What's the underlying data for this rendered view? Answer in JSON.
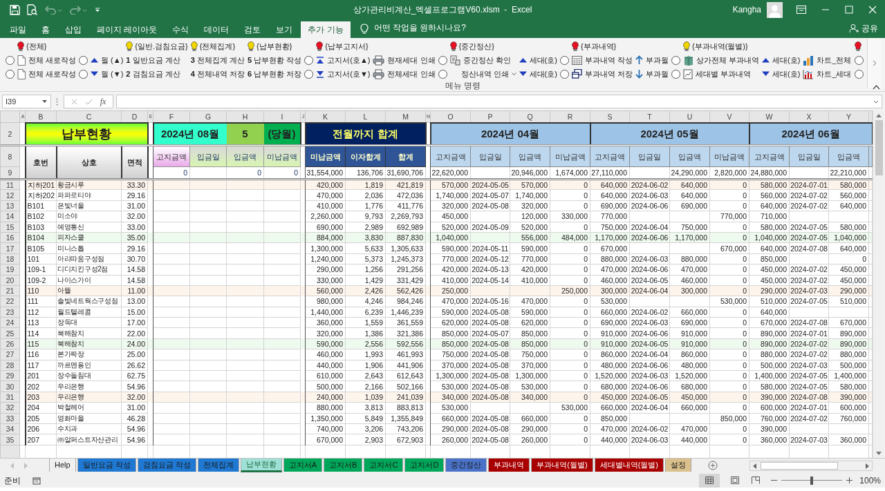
{
  "window": {
    "title": "상가관리비계산_엑셀프로그램V60.xlsm  -  Excel",
    "user": "Kangha"
  },
  "menu_tabs": [
    {
      "label": "파일",
      "selected": false
    },
    {
      "label": "홈",
      "selected": false
    },
    {
      "label": "삽입",
      "selected": false
    },
    {
      "label": "페이지 레이아웃",
      "selected": false
    },
    {
      "label": "수식",
      "selected": false
    },
    {
      "label": "데이터",
      "selected": false
    },
    {
      "label": "검토",
      "selected": false
    },
    {
      "label": "보기",
      "selected": false
    },
    {
      "label": "추가 기능",
      "selected": true
    }
  ],
  "tell_me": "어떤 작업을 원하시나요?",
  "share": "공유",
  "ribbon": {
    "group_label": "메뉴 명령",
    "columns": [
      {
        "items": [
          {
            "kind": "radio",
            "checked": false
          },
          {
            "kind": "radio",
            "checked": false
          }
        ]
      },
      {
        "header": {
          "text": "{전체}",
          "color": "#e81123"
        },
        "items": [
          {
            "kind": "command",
            "text": "전체 새로작성"
          },
          {
            "kind": "command",
            "text": "전체 새로작성"
          }
        ]
      },
      {
        "items": [
          {
            "kind": "radio",
            "checked": false
          },
          {
            "kind": "radio",
            "checked": false
          }
        ]
      },
      {
        "items": [
          {
            "kind": "command",
            "text": "월 (▲)"
          },
          {
            "kind": "command",
            "text": "월 (▼)"
          }
        ]
      },
      {
        "header": {
          "text": "{일반.검침요금}",
          "color": "#f2d600"
        },
        "items": [
          {
            "kind": "command",
            "text": "**1**  일반요금 계산"
          },
          {
            "kind": "command",
            "text": "**2**  검침요금 계산"
          }
        ]
      },
      {
        "header": {
          "text": "{전체집계}",
          "color": "#f2d600"
        },
        "items": [
          {
            "kind": "command",
            "text": "**3**  전체집계 계산"
          },
          {
            "kind": "command",
            "text": "**4**  전체내역 저장"
          }
        ]
      },
      {
        "header": {
          "text": "{납부현황}",
          "color": "#f2d600"
        },
        "items": [
          {
            "kind": "command",
            "text": "**5**  납부현황 작성"
          },
          {
            "kind": "command",
            "text": "**6**  납부현황 저장"
          }
        ]
      },
      {
        "items": [
          {
            "kind": "radio",
            "checked": false
          },
          {
            "kind": "radio",
            "checked": false
          }
        ]
      },
      {
        "header": {
          "text": "{납부고지서}",
          "color": "#e81123"
        },
        "items": [
          {
            "kind": "command",
            "text": "고지서(호▲)"
          },
          {
            "kind": "command",
            "text": "고지서(호▼)"
          }
        ]
      },
      {
        "items": [
          {
            "kind": "command",
            "text": "현재세대 인쇄"
          },
          {
            "kind": "command",
            "text": "전체세대 인쇄"
          }
        ]
      },
      {
        "items": [
          {
            "kind": "radio",
            "checked": false
          },
          {
            "kind": "radio",
            "checked": false
          }
        ]
      },
      {
        "header": {
          "text": "{중간정산}",
          "color": "#e81123"
        },
        "items": [
          {
            "kind": "command",
            "text": "중간정산 확인"
          },
          {
            "kind": "dropdown",
            "text": "정산내역 인쇄"
          }
        ]
      },
      {
        "items": [
          {
            "kind": "command",
            "text": "세대(호)"
          },
          {
            "kind": "command",
            "text": "세대(호)"
          }
        ]
      },
      {
        "items": [
          {
            "kind": "radio",
            "checked": false
          },
          {
            "kind": "radio",
            "checked": false
          }
        ]
      },
      {
        "header": {
          "text": "{부과내역}",
          "color": "#e81123"
        },
        "items": [
          {
            "kind": "command",
            "text": "부과내역 작성"
          },
          {
            "kind": "command",
            "text": "부과내역 저장"
          }
        ]
      },
      {
        "items": [
          {
            "kind": "command",
            "text": "부과월"
          },
          {
            "kind": "command",
            "text": "부과월"
          }
        ]
      },
      {
        "items": [
          {
            "kind": "radio",
            "checked": false
          },
          {
            "kind": "radio",
            "checked": false
          }
        ]
      },
      {
        "header": {
          "text": "{부과내역(월별)}",
          "color": "#f2d600"
        },
        "items": [
          {
            "kind": "command",
            "text": "상가전체 부과내역"
          },
          {
            "kind": "command",
            "text": "세대별 부과내역"
          }
        ]
      },
      {
        "items": [
          {
            "kind": "command",
            "text": "세대(호)"
          },
          {
            "kind": "command",
            "text": "세대(호)"
          }
        ]
      },
      {
        "items": [
          {
            "kind": "command",
            "text": "차트_전체"
          },
          {
            "kind": "command",
            "text": "차트_세대"
          }
        ]
      },
      {
        "header": {
          "color": "#e81123"
        },
        "items": [
          {
            "kind": "radio",
            "checked": false
          },
          {
            "kind": "radio",
            "checked": false
          }
        ]
      }
    ]
  },
  "formula_bar": {
    "name_box": "I39",
    "function_label": "fx"
  },
  "sheet": {
    "column_letters": [
      "A",
      "B",
      "C",
      "D",
      "E",
      "F",
      "G",
      "H",
      "I",
      "J",
      "K",
      "L",
      "M",
      "N",
      "O",
      "P",
      "Q",
      "R",
      "S",
      "T",
      "U",
      "V",
      "W",
      "X",
      "Y"
    ],
    "title": "납부현황",
    "period": {
      "month": "2024년 08월",
      "count": "5",
      "label": "(당월)"
    },
    "prior_title": "전월까지 합계",
    "month_titles": [
      "2024년 04월",
      "2024년 05월",
      "2024년 06월"
    ],
    "title_rows": [
      "2",
      "8",
      "9"
    ],
    "fixed_headers": [
      "호번",
      "상호",
      "면적"
    ],
    "current_headers": [
      "고지금액",
      "입금일",
      "입금액",
      "미납금액"
    ],
    "prior_headers": [
      "미납금액",
      "이자합계",
      "합계"
    ],
    "month_headers": [
      [
        "고지금액",
        "입금일",
        "입금액",
        "미납금액"
      ],
      [
        "고지금액",
        "입금일",
        "입금액",
        "미납금액"
      ],
      [
        "고지금액",
        "입금일",
        "입금액"
      ]
    ],
    "current_totals": {
      "billed": "0",
      "paid": "0",
      "unpaid": "0"
    },
    "prior_totals": [
      "31,554,000",
      "136,706",
      "31,690,706"
    ],
    "month_totals": [
      {
        "billed": "22,620,000",
        "paid": "20,946,000",
        "unpaid": "1,674,000"
      },
      {
        "billed": "27,110,000",
        "paid": "24,290,000",
        "unpaid": "2,820,000"
      },
      {
        "billed": "24,880,000",
        "paid": "22,210,000"
      }
    ],
    "rows": [
      {
        "num": "11",
        "color": "#fdf4ec",
        "unit": "지하201",
        "name": "황금시루",
        "area": "33.30",
        "prior": [
          "420,000",
          "1,819",
          "421,819"
        ],
        "months": [
          {
            "billed": "570,000",
            "date": "2024-05-05",
            "paid": "570,000",
            "unpaid": "0"
          },
          {
            "billed": "640,000",
            "date": "2024-06-02",
            "paid": "640,000",
            "unpaid": "0"
          },
          {
            "billed": "580,000",
            "date": "2024-07-01",
            "paid": "580,000"
          }
        ]
      },
      {
        "num": "12",
        "unit": "지하202",
        "name": "파파로티야",
        "area": "29.16",
        "prior": [
          "470,000",
          "2,036",
          "472,036"
        ],
        "months": [
          {
            "billed": "1,740,000",
            "date": "2024-05-07",
            "paid": "1,740,000",
            "unpaid": "0"
          },
          {
            "billed": "640,000",
            "date": "2024-06-03",
            "paid": "640,000",
            "unpaid": "0"
          },
          {
            "billed": "560,000",
            "date": "2024-07-02",
            "paid": "560,000"
          }
        ]
      },
      {
        "num": "13",
        "unit": "B101",
        "name": "은빛너울",
        "area": "31.00",
        "prior": [
          "410,000",
          "1,776",
          "411,776"
        ],
        "months": [
          {
            "billed": "320,000",
            "date": "2024-05-08",
            "paid": "320,000",
            "unpaid": "0"
          },
          {
            "billed": "690,000",
            "date": "2024-06-06",
            "paid": "690,000",
            "unpaid": "0"
          },
          {
            "billed": "640,000",
            "date": "2024-07-02",
            "paid": "640,000"
          }
        ]
      },
      {
        "num": "14",
        "unit": "B102",
        "name": "미소야",
        "area": "32.00",
        "prior": [
          "2,260,000",
          "9,793",
          "2,269,793"
        ],
        "months": [
          {
            "billed": "450,000",
            "paid": "120,000",
            "unpaid": "330,000"
          },
          {
            "billed": "770,000",
            "unpaid": "770,000"
          },
          {
            "billed": "710,000"
          }
        ]
      },
      {
        "num": "15",
        "unit": "B103",
        "name": "예영통신",
        "area": "33.00",
        "prior": [
          "690,000",
          "2,989",
          "692,989"
        ],
        "months": [
          {
            "billed": "520,000",
            "date": "2024-05-09",
            "paid": "520,000",
            "unpaid": "0"
          },
          {
            "billed": "750,000",
            "date": "2024-06-04",
            "paid": "750,000",
            "unpaid": "0"
          },
          {
            "billed": "580,000",
            "date": "2024-07-05",
            "paid": "580,000"
          }
        ]
      },
      {
        "num": "16",
        "color": "#effaef",
        "unit": "B104",
        "name": "피자스쿨",
        "area": "35.00",
        "prior": [
          "884,000",
          "3,830",
          "887,830"
        ],
        "months": [
          {
            "billed": "1,040,000",
            "paid": "556,000",
            "unpaid": "484,000"
          },
          {
            "billed": "1,170,000",
            "date": "2024-06-06",
            "paid": "1,170,000",
            "unpaid": "0"
          },
          {
            "billed": "1,040,000",
            "date": "2024-07-05",
            "paid": "1,040,000"
          }
        ]
      },
      {
        "num": "17",
        "unit": "B105",
        "name": "미니스톱",
        "area": "29.16",
        "prior": [
          "1,300,000",
          "5,633",
          "1,305,633"
        ],
        "months": [
          {
            "billed": "590,000",
            "date": "2024-05-11",
            "paid": "590,000",
            "unpaid": "0"
          },
          {
            "billed": "670,000",
            "unpaid": "670,000"
          },
          {
            "billed": "640,000",
            "date": "2024-07-08",
            "paid": "640,000"
          }
        ]
      },
      {
        "num": "18",
        "unit": "101",
        "name": "아리따움구성점",
        "area": "30.70",
        "prior": [
          "1,240,000",
          "5,373",
          "1,245,373"
        ],
        "months": [
          {
            "billed": "770,000",
            "date": "2024-05-12",
            "paid": "770,000",
            "unpaid": "0"
          },
          {
            "billed": "880,000",
            "date": "2024-06-03",
            "paid": "880,000",
            "unpaid": "0"
          },
          {
            "billed": "850,000",
            "paid": "0"
          }
        ]
      },
      {
        "num": "19",
        "unit": "109-1",
        "name": "디디치킨구성2점",
        "area": "14.58",
        "prior": [
          "290,000",
          "1,256",
          "291,256"
        ],
        "months": [
          {
            "billed": "420,000",
            "date": "2024-05-13",
            "paid": "420,000",
            "unpaid": "0"
          },
          {
            "billed": "470,000",
            "date": "2024-06-06",
            "paid": "470,000",
            "unpaid": "0"
          },
          {
            "billed": "450,000",
            "date": "2024-07-02",
            "paid": "450,000"
          }
        ]
      },
      {
        "num": "20",
        "unit": "109-2",
        "name": "나이스가이",
        "area": "14.58",
        "prior": [
          "330,000",
          "1,429",
          "331,429"
        ],
        "months": [
          {
            "billed": "410,000",
            "date": "2024-05-14",
            "paid": "410,000",
            "unpaid": "0"
          },
          {
            "billed": "460,000",
            "date": "2024-06-05",
            "paid": "460,000",
            "unpaid": "0"
          },
          {
            "billed": "450,000",
            "date": "2024-07-02",
            "paid": "450,000"
          }
        ]
      },
      {
        "num": "21",
        "color": "#fdf4ec",
        "unit": "110",
        "name": "아뜰",
        "area": "11.00",
        "prior": [
          "560,000",
          "2,426",
          "562,426"
        ],
        "months": [
          {
            "billed": "250,000",
            "unpaid": "250,000"
          },
          {
            "billed": "300,000",
            "date": "2024-06-04",
            "paid": "300,000",
            "unpaid": "0"
          },
          {
            "billed": "290,000",
            "date": "2024-07-03",
            "paid": "290,000"
          }
        ]
      },
      {
        "num": "22",
        "unit": "111",
        "name": "솔빛네트웍스구성점",
        "area": "13.00",
        "prior": [
          "980,000",
          "4,246",
          "984,246"
        ],
        "months": [
          {
            "billed": "470,000",
            "date": "2024-05-16",
            "paid": "470,000",
            "unpaid": "0"
          },
          {
            "billed": "530,000",
            "unpaid": "530,000"
          },
          {
            "billed": "510,000",
            "date": "2024-07-05",
            "paid": "510,000"
          }
        ]
      },
      {
        "num": "23",
        "unit": "112",
        "name": "월드텔레콤",
        "area": "15.00",
        "prior": [
          "1,440,000",
          "6,239",
          "1,446,239"
        ],
        "months": [
          {
            "billed": "590,000",
            "date": "2024-05-08",
            "paid": "590,000",
            "unpaid": "0"
          },
          {
            "billed": "660,000",
            "date": "2024-06-02",
            "paid": "660,000",
            "unpaid": "0"
          },
          {
            "billed": "640,000"
          }
        ]
      },
      {
        "num": "24",
        "unit": "113",
        "name": "장독대",
        "area": "17.00",
        "prior": [
          "360,000",
          "1,559",
          "361,559"
        ],
        "months": [
          {
            "billed": "620,000",
            "date": "2024-05-08",
            "paid": "620,000",
            "unpaid": "0"
          },
          {
            "billed": "690,000",
            "date": "2024-06-03",
            "paid": "690,000",
            "unpaid": "0"
          },
          {
            "billed": "670,000",
            "date": "2024-07-08",
            "paid": "670,000"
          }
        ]
      },
      {
        "num": "25",
        "unit": "114",
        "name": "북해참치",
        "area": "22.00",
        "prior": [
          "320,000",
          "1,386",
          "321,386"
        ],
        "months": [
          {
            "billed": "850,000",
            "date": "2024-05-07",
            "paid": "850,000",
            "unpaid": "0"
          },
          {
            "billed": "910,000",
            "date": "2024-06-06",
            "paid": "910,000",
            "unpaid": "0"
          },
          {
            "billed": "890,000",
            "date": "2024-07-01",
            "paid": "890,000"
          }
        ]
      },
      {
        "num": "26",
        "color": "#effaef",
        "unit": "115",
        "name": "북해참치",
        "area": "24.00",
        "prior": [
          "590,000",
          "2,556",
          "592,556"
        ],
        "months": [
          {
            "billed": "850,000",
            "date": "2024-05-08",
            "paid": "850,000",
            "unpaid": "0"
          },
          {
            "billed": "910,000",
            "date": "2024-06-05",
            "paid": "910,000",
            "unpaid": "0"
          },
          {
            "billed": "890,000",
            "date": "2024-07-02",
            "paid": "890,000"
          }
        ]
      },
      {
        "num": "27",
        "unit": "116",
        "name": "본가짜장",
        "area": "25.00",
        "prior": [
          "460,000",
          "1,993",
          "461,993"
        ],
        "months": [
          {
            "billed": "750,000",
            "date": "2024-05-08",
            "paid": "750,000",
            "unpaid": "0"
          },
          {
            "billed": "860,000",
            "date": "2024-06-04",
            "paid": "860,000",
            "unpaid": "0"
          },
          {
            "billed": "880,000",
            "date": "2024-07-02",
            "paid": "880,000"
          }
        ]
      },
      {
        "num": "28",
        "unit": "117",
        "name": "까르멘용인",
        "area": "26.62",
        "prior": [
          "440,000",
          "1,906",
          "441,906"
        ],
        "months": [
          {
            "billed": "370,000",
            "date": "2024-05-08",
            "paid": "370,000",
            "unpaid": "0"
          },
          {
            "billed": "480,000",
            "date": "2024-06-06",
            "paid": "480,000",
            "unpaid": "0"
          },
          {
            "billed": "500,000",
            "date": "2024-07-03",
            "paid": "500,000"
          }
        ]
      },
      {
        "num": "29",
        "unit": "201",
        "name": "장수돌침대",
        "area": "62.75",
        "prior": [
          "610,000",
          "2,643",
          "612,643"
        ],
        "months": [
          {
            "billed": "1,300,000",
            "date": "2024-05-08",
            "paid": "1,300,000",
            "unpaid": "0"
          },
          {
            "billed": "1,520,000",
            "date": "2024-06-03",
            "paid": "1,520,000",
            "unpaid": "0"
          },
          {
            "billed": "1,400,000",
            "date": "2024-07-05",
            "paid": "1,400,000"
          }
        ]
      },
      {
        "num": "30",
        "unit": "202",
        "name": "우리은행",
        "area": "54.96",
        "prior": [
          "500,000",
          "2,166",
          "502,166"
        ],
        "months": [
          {
            "billed": "530,000",
            "date": "2024-05-08",
            "paid": "530,000",
            "unpaid": "0"
          },
          {
            "billed": "680,000",
            "date": "2024-06-06",
            "paid": "680,000",
            "unpaid": "0"
          },
          {
            "billed": "580,000",
            "date": "2024-07-05",
            "paid": "580,000"
          }
        ]
      },
      {
        "num": "31",
        "color": "#fdf4ec",
        "unit": "203",
        "name": "우리은행",
        "area": "32.00",
        "prior": [
          "240,000",
          "1,039",
          "241,039"
        ],
        "months": [
          {
            "billed": "340,000",
            "date": "2024-05-08",
            "paid": "340,000",
            "unpaid": "0"
          },
          {
            "billed": "450,000",
            "date": "2024-06-05",
            "paid": "450,000",
            "unpaid": "0"
          },
          {
            "billed": "390,000",
            "date": "2024-07-08",
            "paid": "390,000"
          }
        ]
      },
      {
        "num": "32",
        "unit": "204",
        "name": "박철헤어",
        "area": "31.00",
        "prior": [
          "880,000",
          "3,813",
          "883,813"
        ],
        "months": [
          {
            "billed": "530,000",
            "unpaid": "530,000"
          },
          {
            "billed": "660,000",
            "date": "2024-06-04",
            "paid": "660,000",
            "unpaid": "0"
          },
          {
            "billed": "600,000",
            "date": "2024-07-01",
            "paid": "600,000"
          }
        ]
      },
      {
        "num": "33",
        "unit": "205",
        "name": "영화마을",
        "area": "46.28",
        "prior": [
          "1,350,000",
          "5,849",
          "1,355,849"
        ],
        "months": [
          {
            "billed": "660,000",
            "date": "2024-05-08",
            "paid": "660,000",
            "unpaid": "0"
          },
          {
            "billed": "850,000",
            "unpaid": "850,000"
          },
          {
            "billed": "760,000",
            "date": "2024-07-02",
            "paid": "760,000"
          }
        ]
      },
      {
        "num": "34",
        "unit": "206",
        "name": "수치과",
        "area": "54.96",
        "prior": [
          "740,000",
          "3,206",
          "743,206"
        ],
        "months": [
          {
            "billed": "290,000",
            "date": "2024-05-08",
            "paid": "290,000",
            "unpaid": "0"
          },
          {
            "billed": "470,000",
            "date": "2024-06-02",
            "paid": "470,000",
            "unpaid": "0"
          },
          {
            "billed": "390,000"
          }
        ]
      },
      {
        "num": "35",
        "unit": "207",
        "name": "㈜알퍼스트자산관리",
        "area": "54.96",
        "prior": [
          "670,000",
          "2,903",
          "672,903"
        ],
        "months": [
          {
            "billed": "260,000",
            "date": "2024-05-08",
            "paid": "260,000",
            "unpaid": "0"
          },
          {
            "billed": "440,000",
            "date": "2024-06-03",
            "paid": "440,000",
            "unpaid": "0"
          },
          {
            "billed": "360,000",
            "date": "2024-07-03",
            "paid": "360,000"
          }
        ]
      }
    ]
  },
  "sheet_tabs": [
    {
      "label": "Help",
      "selected": false,
      "color": "#f0f0f0"
    },
    {
      "label": "일반요금 작성",
      "selected": false,
      "color": "#1f78d1"
    },
    {
      "label": "검침요금 작성",
      "selected": false,
      "color": "#1f78d1"
    },
    {
      "label": "전체집계",
      "selected": false,
      "color": "#1f78d1"
    },
    {
      "label": "납부현황",
      "selected": true,
      "color": "#9fe0d6"
    },
    {
      "label": "고지서A",
      "selected": false,
      "color": "#00a65a"
    },
    {
      "label": "고지서B",
      "selected": false,
      "color": "#00a65a"
    },
    {
      "label": "고지서C",
      "selected": false,
      "color": "#00a65a"
    },
    {
      "label": "고지서D",
      "selected": false,
      "color": "#00a65a"
    },
    {
      "label": "중간정산",
      "selected": false,
      "color": "#4a72c8"
    },
    {
      "label": "부과내역",
      "selected": false,
      "color": "#a80000"
    },
    {
      "label": "부과내역(월별)",
      "selected": false,
      "color": "#a80000"
    },
    {
      "label": "세대별내역(월별)",
      "selected": false,
      "color": "#a80000"
    },
    {
      "label": "설정",
      "selected": false,
      "color": "#d9c08c"
    }
  ],
  "status_bar": {
    "status": "준비",
    "zoom": "100%",
    "zoom_slider": {
      "level": 0.5
    }
  }
}
